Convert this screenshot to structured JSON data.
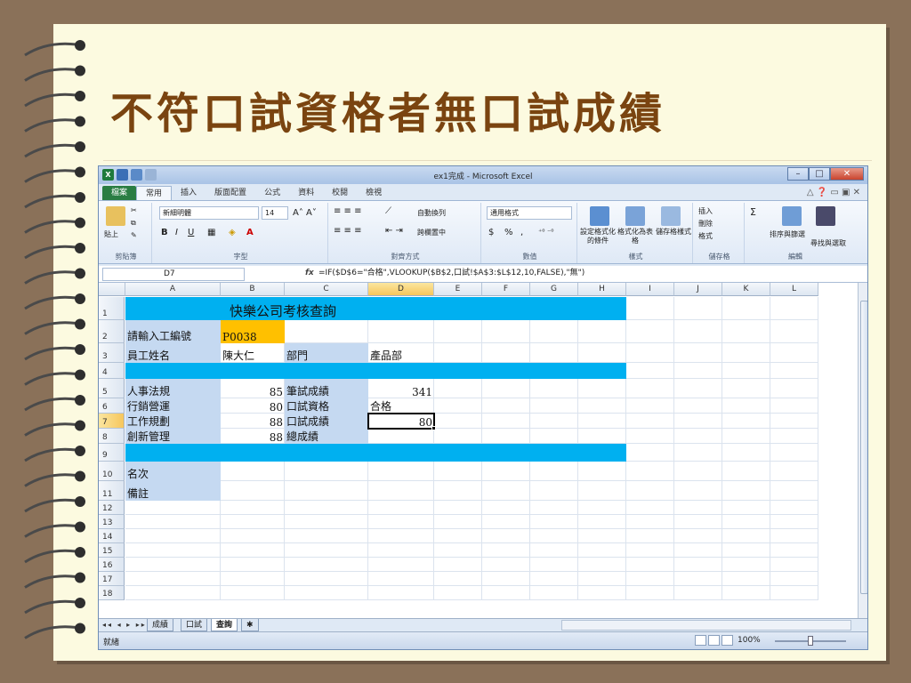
{
  "slide": {
    "title": "不符口試資格者無口試成績"
  },
  "window": {
    "title": "ex1完成 - Microsoft Excel"
  },
  "tabs": [
    "檔案",
    "常用",
    "插入",
    "版面配置",
    "公式",
    "資料",
    "校閱",
    "檢視"
  ],
  "active_tab": "常用",
  "ribbon": {
    "clipboard": {
      "label": "剪貼簿",
      "paste": "貼上"
    },
    "font": {
      "label": "字型",
      "name": "新細明體",
      "size": "14",
      "bold": "B",
      "italic": "I",
      "underline": "U"
    },
    "alignment": {
      "label": "對齊方式",
      "wrap": "自動換列",
      "merge": "跨欄置中"
    },
    "number": {
      "label": "數值",
      "format": "通用格式",
      "currency": "$",
      "percent": "%",
      "comma": ","
    },
    "styles": {
      "label": "樣式",
      "conditional": "設定格式化的條件",
      "as_table": "格式化為表格",
      "cell_styles": "儲存格樣式"
    },
    "cells": {
      "label": "儲存格",
      "insert": "插入",
      "delete": "刪除",
      "format": "格式"
    },
    "editing": {
      "label": "編輯",
      "sort": "排序與篩選",
      "find": "尋找與選取"
    }
  },
  "formula_bar": {
    "name_box": "D7",
    "fx": "fx",
    "formula": "=IF($D$6=\"合格\",VLOOKUP($B$2,口試!$A$3:$L$12,10,FALSE),\"無\")"
  },
  "columns": [
    "A",
    "B",
    "C",
    "D",
    "E",
    "F",
    "G",
    "H",
    "I",
    "J",
    "K",
    "L"
  ],
  "rows": [
    "1",
    "2",
    "3",
    "4",
    "5",
    "6",
    "7",
    "8",
    "9",
    "10",
    "11",
    "12",
    "13",
    "14",
    "15",
    "16",
    "17",
    "18"
  ],
  "cells": {
    "B1": "快樂公司考核查詢",
    "A2": "請輸入工編號",
    "B2": "P0038",
    "A3": "員工姓名",
    "B3": "陳大仁",
    "C3": "部門",
    "D3": "產品部",
    "A5": "人事法規",
    "B5": "85",
    "C5": "筆試成績",
    "D5": "341",
    "A6": "行銷營運",
    "B6": "80",
    "C6": "口試資格",
    "D6": "合格",
    "A7": "工作規劃",
    "B7": "88",
    "C7": "口試成績",
    "D7": "80",
    "A8": "創新管理",
    "B8": "88",
    "C8": "總成績",
    "A10": "名次",
    "A11": "備註"
  },
  "sheets": [
    "成績",
    "口試",
    "查詢"
  ],
  "active_sheet": "查詢",
  "status": {
    "ready": "就緒",
    "zoom": "100%"
  },
  "colors": {
    "band": "#00b0f0",
    "label": "#c5d9f1",
    "input": "#ffc000",
    "title": "#7a4410"
  }
}
